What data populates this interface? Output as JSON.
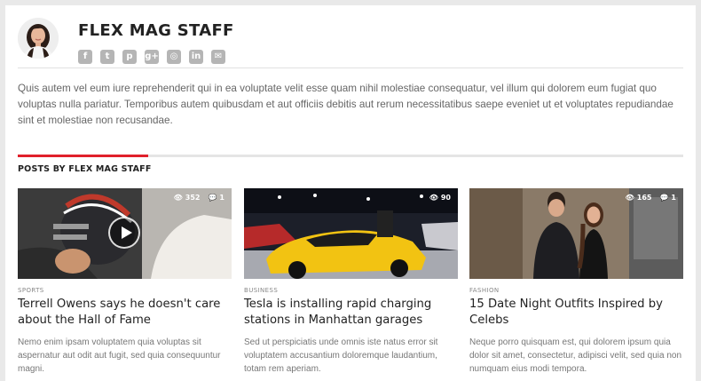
{
  "author": {
    "name": "FLEX MAG STAFF",
    "social_icons": [
      "facebook-icon",
      "twitter-icon",
      "pinterest-icon",
      "google-plus-icon",
      "instagram-icon",
      "linkedin-icon",
      "email-icon"
    ],
    "social_glyphs": [
      "f",
      "t",
      "p",
      "g+",
      "◎",
      "in",
      "✉"
    ],
    "bio": "Quis autem vel eum iure reprehenderit qui in ea voluptate velit esse quam nihil molestiae consequatur, vel illum qui dolorem eum fugiat quo voluptas nulla pariatur. Temporibus autem quibusdam et aut officiis debitis aut rerum necessitatibus saepe eveniet ut et voluptates repudiandae sint et molestiae non recusandae."
  },
  "section": {
    "title": "POSTS BY FLEX MAG STAFF",
    "accent_color": "#e0202b"
  },
  "posts": [
    {
      "category": "SPORTS",
      "title": "Terrell Owens says he doesn't care about the Hall of Fame",
      "excerpt": "Nemo enim ipsam voluptatem quia voluptas sit aspernatur aut odit aut fugit, sed quia consequuntur magni.",
      "views": "352",
      "comments": "1"
    },
    {
      "category": "BUSINESS",
      "title": "Tesla is installing rapid charging stations in Manhattan garages",
      "excerpt": "Sed ut perspiciatis unde omnis iste natus error sit voluptatem accusantium doloremque laudantium, totam rem aperiam.",
      "views": "90"
    },
    {
      "category": "FASHION",
      "title": "15 Date Night Outfits Inspired by Celebs",
      "excerpt": "Neque porro quisquam est, qui dolorem ipsum quia dolor sit amet, consectetur, adipisci velit, sed quia non numquam eius modi tempora.",
      "views": "165",
      "comments": "1"
    }
  ]
}
